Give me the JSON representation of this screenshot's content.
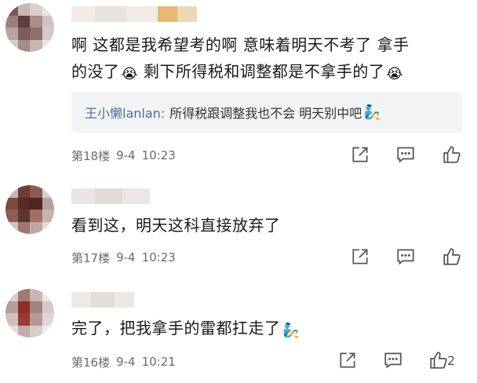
{
  "comments": [
    {
      "text_line1": "啊 这都是我希望考的啊 意味着明天不考了 拿手",
      "text_line2": "的没了",
      "text_line2b": "剩下所得税和调整都是不拿手的了",
      "emoji": "😭",
      "reply": {
        "name": "王小懒lanlan:",
        "text": "所得税跟调整我也不会 明天别中吧",
        "emoji": "🧞"
      },
      "floor": "第18楼",
      "date": "9-4",
      "time": "10:23"
    },
    {
      "text": "看到这，明天这科直接放弃了",
      "floor": "第17楼",
      "date": "9-4",
      "time": "10:23"
    },
    {
      "text": "完了，把我拿手的雷都扛走了",
      "emoji": "🧞",
      "floor": "第16楼",
      "date": "9-4",
      "time": "10:21",
      "likes": "2"
    }
  ],
  "icons": {
    "share": "share-icon",
    "comment": "comment-icon",
    "like": "thumbs-up-icon"
  }
}
